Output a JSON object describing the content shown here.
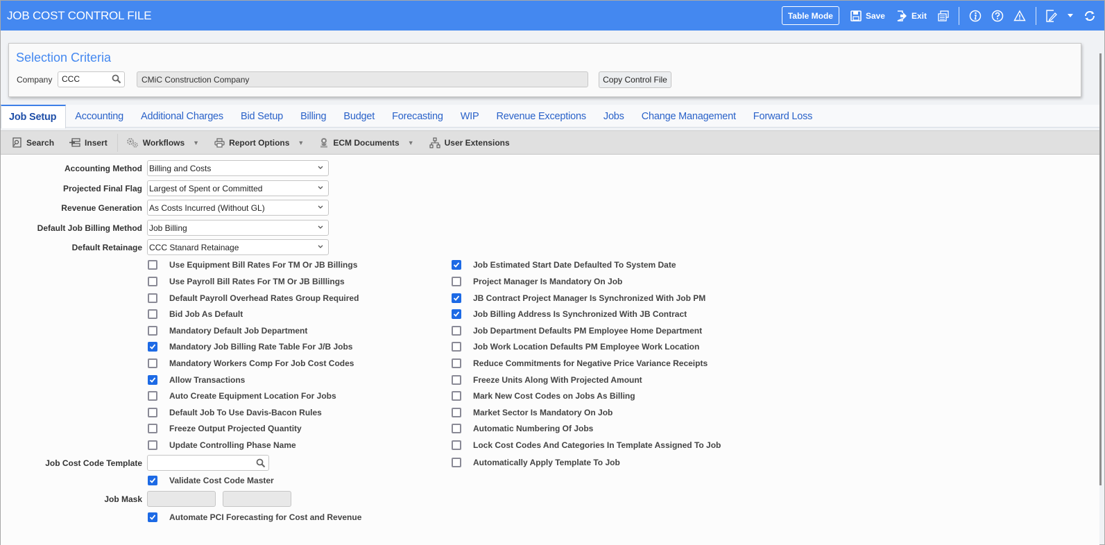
{
  "header": {
    "title": "JOB COST CONTROL FILE",
    "table_mode_label": "Table Mode",
    "save_label": "Save",
    "exit_label": "Exit",
    "icons": [
      "print-icon",
      "info-icon",
      "help-icon",
      "warning-icon",
      "edit-note-icon",
      "dropdown-caret-icon",
      "refresh-icon"
    ]
  },
  "selection": {
    "title": "Selection Criteria",
    "company_label": "Company",
    "company_value": "CCC",
    "company_name": "CMiC Construction Company",
    "copy_button": "Copy Control File"
  },
  "tabs": [
    {
      "label": "Job Setup",
      "active": true
    },
    {
      "label": "Accounting"
    },
    {
      "label": "Additional Charges"
    },
    {
      "label": "Bid Setup"
    },
    {
      "label": "Billing"
    },
    {
      "label": "Budget"
    },
    {
      "label": "Forecasting"
    },
    {
      "label": "WIP"
    },
    {
      "label": "Revenue Exceptions"
    },
    {
      "label": "Jobs"
    },
    {
      "label": "Change Management"
    },
    {
      "label": "Forward Loss"
    }
  ],
  "toolbar": {
    "search": "Search",
    "insert": "Insert",
    "workflows": "Workflows",
    "report_options": "Report Options",
    "ecm_documents": "ECM Documents",
    "user_extensions": "User Extensions"
  },
  "form": {
    "selects": [
      {
        "label": "Accounting Method",
        "value": "Billing and Costs"
      },
      {
        "label": "Projected Final Flag",
        "value": "Largest of Spent or Committed"
      },
      {
        "label": "Revenue Generation",
        "value": "As Costs Incurred (Without GL)"
      },
      {
        "label": "Default Job Billing Method",
        "value": "Job Billing"
      },
      {
        "label": "Default Retainage",
        "value": "CCC Stanard Retainage"
      }
    ],
    "left_checkboxes": [
      {
        "label": "Use Equipment Bill Rates For TM Or JB Billings",
        "checked": false
      },
      {
        "label": "Use Payroll Bill Rates For TM Or JB Billlings",
        "checked": false
      },
      {
        "label": "Default Payroll Overhead Rates Group Required",
        "checked": false
      },
      {
        "label": "Bid Job As Default",
        "checked": false
      },
      {
        "label": "Mandatory Default Job Department",
        "checked": false
      },
      {
        "label": "Mandatory Job Billing Rate Table For J/B Jobs",
        "checked": true
      },
      {
        "label": "Mandatory Workers Comp For Job Cost Codes",
        "checked": false
      },
      {
        "label": "Allow Transactions",
        "checked": true
      },
      {
        "label": "Auto Create Equipment Location For Jobs",
        "checked": false
      },
      {
        "label": "Default Job To Use Davis-Bacon Rules",
        "checked": false
      },
      {
        "label": "Freeze Output Projected Quantity",
        "checked": false
      },
      {
        "label": "Update Controlling Phase Name",
        "checked": false
      }
    ],
    "right_checkboxes": [
      {
        "label": "Job Estimated Start Date Defaulted To System Date",
        "checked": true
      },
      {
        "label": "Project Manager Is Mandatory On Job",
        "checked": false
      },
      {
        "label": "JB Contract Project Manager Is Synchronized With Job PM",
        "checked": true
      },
      {
        "label": "Job Billing Address Is Synchronized With JB Contract",
        "checked": true
      },
      {
        "label": "Job Department Defaults PM Employee Home Department",
        "checked": false
      },
      {
        "label": "Job Work Location Defaults PM Employee Work Location",
        "checked": false
      },
      {
        "label": "Reduce Commitments for Negative Price Variance Receipts",
        "checked": false
      },
      {
        "label": "Freeze Units Along With Projected Amount",
        "checked": false
      },
      {
        "label": "Mark New Cost Codes on Jobs As Billing",
        "checked": false
      },
      {
        "label": "Market Sector Is Mandatory On Job",
        "checked": false
      },
      {
        "label": "Automatic Numbering Of Jobs",
        "checked": false
      },
      {
        "label": "Lock Cost Codes And Categories In Template Assigned To Job",
        "checked": false
      },
      {
        "label": "Automatically Apply Template To Job",
        "checked": false
      }
    ],
    "job_cost_code_template_label": "Job Cost Code Template",
    "job_cost_code_template_value": "",
    "validate_cost_code_master": {
      "label": "Validate Cost Code Master",
      "checked": true
    },
    "job_mask_label": "Job Mask",
    "job_mask_values": [
      "",
      ""
    ],
    "automate_pci": {
      "label": "Automate PCI Forecasting for Cost and Revenue",
      "checked": true
    }
  }
}
